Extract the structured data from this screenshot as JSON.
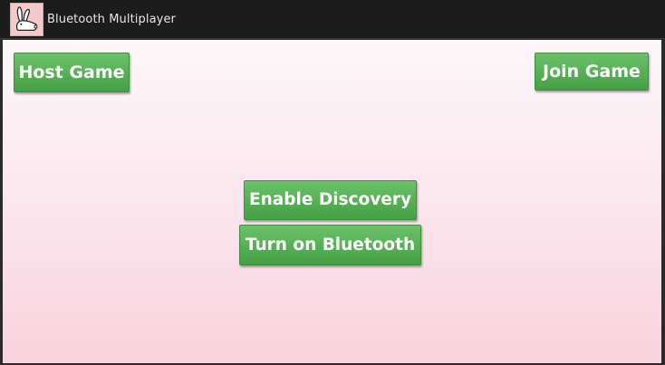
{
  "window": {
    "title": "Bluetooth Multiplayer",
    "icon": "bunny-icon"
  },
  "buttons": {
    "host_game": "Host Game",
    "join_game": "Join Game",
    "enable_discovery": "Enable Discovery",
    "turn_on_bluetooth": "Turn on Bluetooth"
  },
  "colors": {
    "button_green": "#58b157",
    "titlebar": "#1c1c1c",
    "background_top": "#fdf7fa",
    "background_bottom": "#f9d2dd",
    "icon_bg": "#f4c9c9"
  }
}
